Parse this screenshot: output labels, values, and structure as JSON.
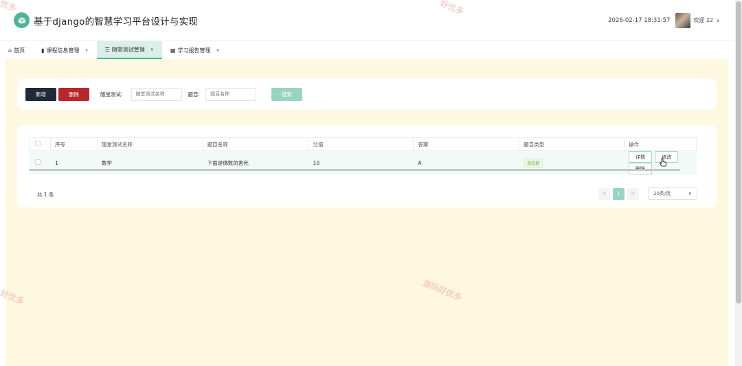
{
  "header": {
    "title": "基于django的智慧学习平台设计与实现",
    "datetime": "2026-02-17 18:31:57",
    "welcome": "欢迎 22",
    "user_chevron": "∨"
  },
  "nav": {
    "items": [
      {
        "label": "首页",
        "icon": "home-icon",
        "has_dropdown": false
      },
      {
        "label": "课程信息管理",
        "icon": "book-icon",
        "has_dropdown": true
      },
      {
        "label": "随堂测试管理",
        "icon": "list-icon",
        "has_dropdown": true,
        "active": true
      },
      {
        "label": "学习报告管理",
        "icon": "grid-icon",
        "has_dropdown": true
      }
    ],
    "dropdown_symbol": "∨"
  },
  "search": {
    "add_label": "新增",
    "delete_label": "删除",
    "test_label": "随堂测试:",
    "test_placeholder": "随堂测试名称",
    "question_label": "题目:",
    "question_placeholder": "题目名称",
    "search_label": "搜索"
  },
  "table": {
    "headers": [
      "序号",
      "随堂测试名称",
      "题目名称",
      "分值",
      "答案",
      "题目类型",
      "操作"
    ],
    "rows": [
      {
        "seq": "1",
        "test_name": "数学",
        "question": "下面是偶数的害死",
        "score": "10",
        "answer": "A",
        "type": "单选题",
        "actions": [
          "详情",
          "修改",
          "删除"
        ]
      }
    ]
  },
  "pagination": {
    "total": "共 1 条",
    "prev": "<",
    "current": "1",
    "next": ">",
    "page_size": "20条/页",
    "size_chevron": "∨"
  },
  "watermark": {
    "text": "源码好优多",
    "partial_top": "好优多",
    "partial_left": "好优多",
    "partial_topleft": "优多"
  },
  "colors": {
    "accent": "#4fb39a",
    "content_bg": "#fff8e1",
    "add_button": "#1f2937",
    "delete_button": "#b8282b",
    "search_button": "#98d4c2"
  }
}
